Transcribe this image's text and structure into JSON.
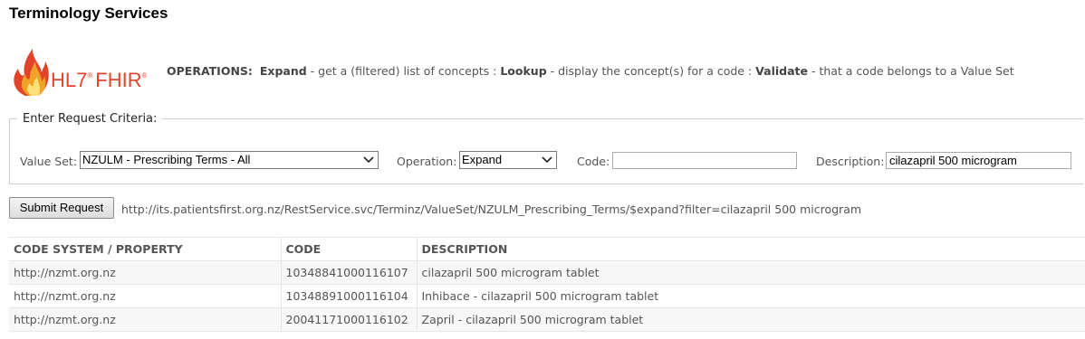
{
  "header": {
    "title": "Terminology Services"
  },
  "logo": {
    "text": "HL7",
    "reg": "®",
    "suffix": "FHIR",
    "reg2": "®"
  },
  "operations": {
    "heading": "OPERATIONS:",
    "expand_label": "Expand",
    "expand_desc": " - get a (filtered) list of concepts : ",
    "lookup_label": "Lookup",
    "lookup_desc": " - display the concept(s) for a code : ",
    "validate_label": "Validate",
    "validate_desc": " - that a code belongs to a Value Set"
  },
  "criteria": {
    "legend": "Enter Request Criteria:",
    "value_set_label": "Value Set:",
    "value_set_selected": "NZULM - Prescribing Terms - All",
    "operation_label": "Operation:",
    "operation_selected": "Expand",
    "code_label": "Code:",
    "code_value": "",
    "description_label": "Description:",
    "description_value": "cilazapril 500 microgram"
  },
  "request": {
    "submit_label": "Submit Request",
    "url": "http://its.patientsfirst.org.nz/RestService.svc/Terminz/ValueSet/NZULM_Prescribing_Terms/$expand?filter=cilazapril 500 microgram"
  },
  "results": {
    "columns": [
      "CODE SYSTEM / PROPERTY",
      "CODE",
      "DESCRIPTION"
    ],
    "rows": [
      [
        "http://nzmt.org.nz",
        "10348841000116107",
        "cilazapril 500 microgram tablet"
      ],
      [
        "http://nzmt.org.nz",
        "10348891000116104",
        "Inhibace - cilazapril 500 microgram tablet"
      ],
      [
        "http://nzmt.org.nz",
        "20041171000116102",
        "Zapril - cilazapril 500 microgram tablet"
      ]
    ]
  },
  "colors": {
    "logo_red": "#e2442b",
    "logo_orange": "#f3a228",
    "text_gray": "#555555"
  },
  "icons": {
    "logo_flame": "flame-icon",
    "select_arrow": "chevron-down-icon"
  }
}
